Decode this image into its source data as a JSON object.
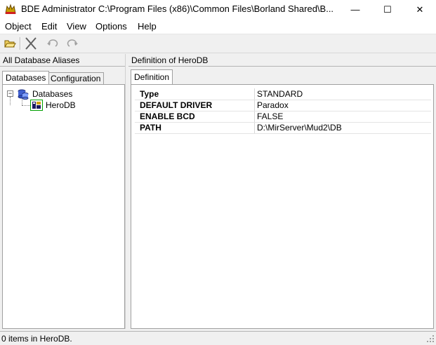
{
  "window": {
    "title": "BDE Administrator  C:\\Program Files (x86)\\Common Files\\Borland Shared\\B...",
    "minimize": "—",
    "maximize": "☐",
    "close": "✕"
  },
  "menu": [
    "Object",
    "Edit",
    "View",
    "Options",
    "Help"
  ],
  "toolbar": {
    "buttons": [
      "open-folder-icon",
      "delete-icon",
      "undo-icon",
      "redo-icon"
    ]
  },
  "left_panel": {
    "header": "All Database Aliases",
    "tabs": [
      "Databases",
      "Configuration"
    ],
    "active_tab": "Databases",
    "tree": {
      "root": "Databases",
      "root_expander": "−",
      "children": [
        "HeroDB"
      ]
    }
  },
  "right_panel": {
    "header": "Definition of HeroDB",
    "tabs": [
      "Definition"
    ],
    "rows": [
      {
        "name": "Type",
        "value": "STANDARD"
      },
      {
        "name": "DEFAULT DRIVER",
        "value": "Paradox"
      },
      {
        "name": "ENABLE BCD",
        "value": "FALSE"
      },
      {
        "name": "PATH",
        "value": "D:\\MirServer\\Mud2\\DB"
      }
    ]
  },
  "status": {
    "text": "0 items in HeroDB."
  },
  "colors": {
    "selection_outline": "#00a000",
    "window_bg": "#f0f0f0"
  }
}
